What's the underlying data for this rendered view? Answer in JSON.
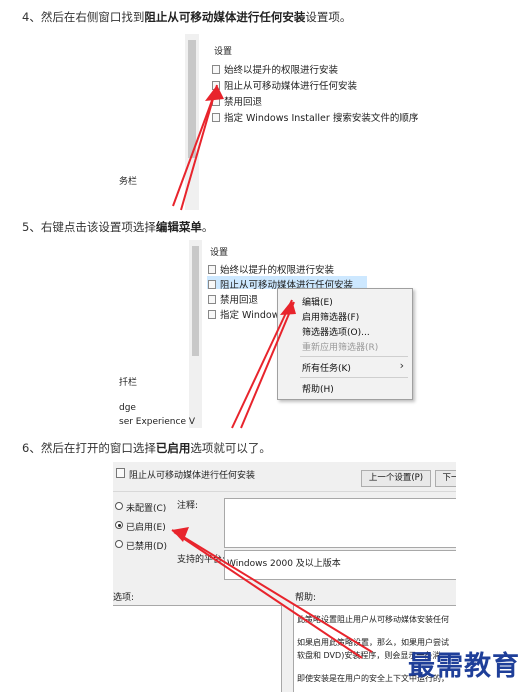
{
  "steps": {
    "s4": {
      "num": "4、",
      "pre": "然后在右侧窗口找到",
      "bold": "阻止从可移动媒体进行任何安装",
      "post": "设置项。"
    },
    "s5": {
      "num": "5、",
      "pre": "右键点击该设置项选择",
      "bold": "编辑菜单",
      "post": "。"
    },
    "s6": {
      "num": "6、",
      "pre": "然后在打开的窗口选择",
      "bold": "已启用",
      "post": "选项就可以了。"
    }
  },
  "shot1": {
    "header": "设置",
    "items": [
      "始终以提升的权限进行安装",
      "阻止从可移动媒体进行任何安装",
      "禁用回退",
      "指定 Windows Installer 搜索安装文件的顺序"
    ],
    "left_partial": "务栏"
  },
  "shot2": {
    "header": "设置",
    "items": [
      "始终以提升的权限进行安装",
      "阻止从可移动媒体进行任何安装",
      "禁用回退",
      "指定 Windows"
    ],
    "left_partial": [
      "扦栏",
      "dge",
      "ser Experience V"
    ],
    "context_menu": [
      "编辑(E)",
      "启用筛选器(F)",
      "筛选器选项(O)...",
      "重新应用筛选器(R)",
      "所有任务(K)",
      "帮助(H)"
    ],
    "submenu_arrow": "›"
  },
  "shot3": {
    "title": "阻止从可移动媒体进行任何安装",
    "prev_button": "上一个设置(P)",
    "next_button": "下一",
    "radios": [
      "未配置(C)",
      "已启用(E)",
      "已禁用(D)"
    ],
    "selected_radio": 1,
    "comment_label": "注释:",
    "supported_label": "支持的平台:",
    "supported_value": "Windows 2000 及以上版本",
    "options_label": "选项:",
    "help_label": "帮助:",
    "help_lines": [
      "此策略设置阻止用户从可移动媒体安装任何",
      "如果启用此策略设置，那么，如果用户尝试",
      "软盘和 DVD)安装程序，则会显示一条消",
      "即使安装是在用户的安全上下文中运行的，"
    ]
  },
  "watermark": "最需教育",
  "colors": {
    "arrow": "#e8242c",
    "selection": "#cde8ff",
    "watermark": "#1f3f99"
  }
}
